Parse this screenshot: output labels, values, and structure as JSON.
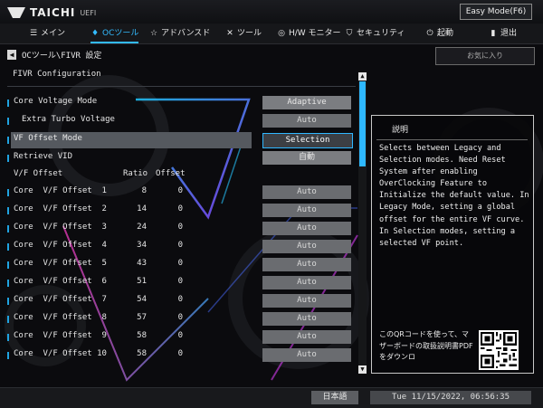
{
  "app": {
    "brand": "TAICHI",
    "suffix": "UEFI",
    "easy_mode_button": "Easy Mode(F6)"
  },
  "nav": {
    "items": [
      {
        "label": "メイン",
        "icon": "list-icon"
      },
      {
        "label": "OCツール",
        "icon": "flame-icon",
        "active": true
      },
      {
        "label": "アドバンスド",
        "icon": "star-icon"
      },
      {
        "label": "ツール",
        "icon": "tools-icon"
      },
      {
        "label": "H/W モニター",
        "icon": "monitor-icon"
      },
      {
        "label": "セキュリティ",
        "icon": "shield-icon"
      },
      {
        "label": "起動",
        "icon": "power-icon"
      },
      {
        "label": "退出",
        "icon": "exit-icon"
      }
    ]
  },
  "breadcrumb": "OCツール\\FIVR 設定",
  "favorite_button": "お気に入り",
  "section_title": "FIVR Configuration",
  "settings": {
    "core_voltage_mode": {
      "label": "Core Voltage Mode",
      "value": "Adaptive"
    },
    "extra_turbo_voltage": {
      "label": "Extra Turbo Voltage",
      "value": "Auto"
    },
    "vf_offset_mode": {
      "label": "VF Offset Mode",
      "value": "Selection"
    },
    "retrieve_vid": {
      "label": "Retrieve VID",
      "value": "自動"
    }
  },
  "vf_table": {
    "header_label": "V/F Offset",
    "header_ratio": "Ratio",
    "header_offset": "Offset",
    "rows": [
      {
        "label": "Core  V/F Offset  1",
        "ratio": "8",
        "offset": "0",
        "value": "Auto"
      },
      {
        "label": "Core  V/F Offset  2",
        "ratio": "14",
        "offset": "0",
        "value": "Auto"
      },
      {
        "label": "Core  V/F Offset  3",
        "ratio": "24",
        "offset": "0",
        "value": "Auto"
      },
      {
        "label": "Core  V/F Offset  4",
        "ratio": "34",
        "offset": "0",
        "value": "Auto"
      },
      {
        "label": "Core  V/F Offset  5",
        "ratio": "43",
        "offset": "0",
        "value": "Auto"
      },
      {
        "label": "Core  V/F Offset  6",
        "ratio": "51",
        "offset": "0",
        "value": "Auto"
      },
      {
        "label": "Core  V/F Offset  7",
        "ratio": "54",
        "offset": "0",
        "value": "Auto"
      },
      {
        "label": "Core  V/F Offset  8",
        "ratio": "57",
        "offset": "0",
        "value": "Auto"
      },
      {
        "label": "Core  V/F Offset  9",
        "ratio": "58",
        "offset": "0",
        "value": "Auto"
      },
      {
        "label": "Core  V/F Offset 10",
        "ratio": "58",
        "offset": "0",
        "value": "Auto"
      }
    ]
  },
  "description": {
    "title": "説明",
    "body": "Selects between Legacy and Selection modes. Need Reset System after enabling OverClocking Feature to Initialize the default value. In Legacy Mode, setting a global offset for the entire VF curve. In Selection modes, setting a selected VF point.",
    "qr_text": "このQRコードを使って、マザーボードの取扱説明書PDFをダウンロ"
  },
  "footer": {
    "language": "日本語",
    "datetime": "Tue 11/15/2022, 06:56:35"
  },
  "colors": {
    "accent": "#2eb8ff",
    "background": "#0b0b0e",
    "button": "#6a6c70"
  }
}
